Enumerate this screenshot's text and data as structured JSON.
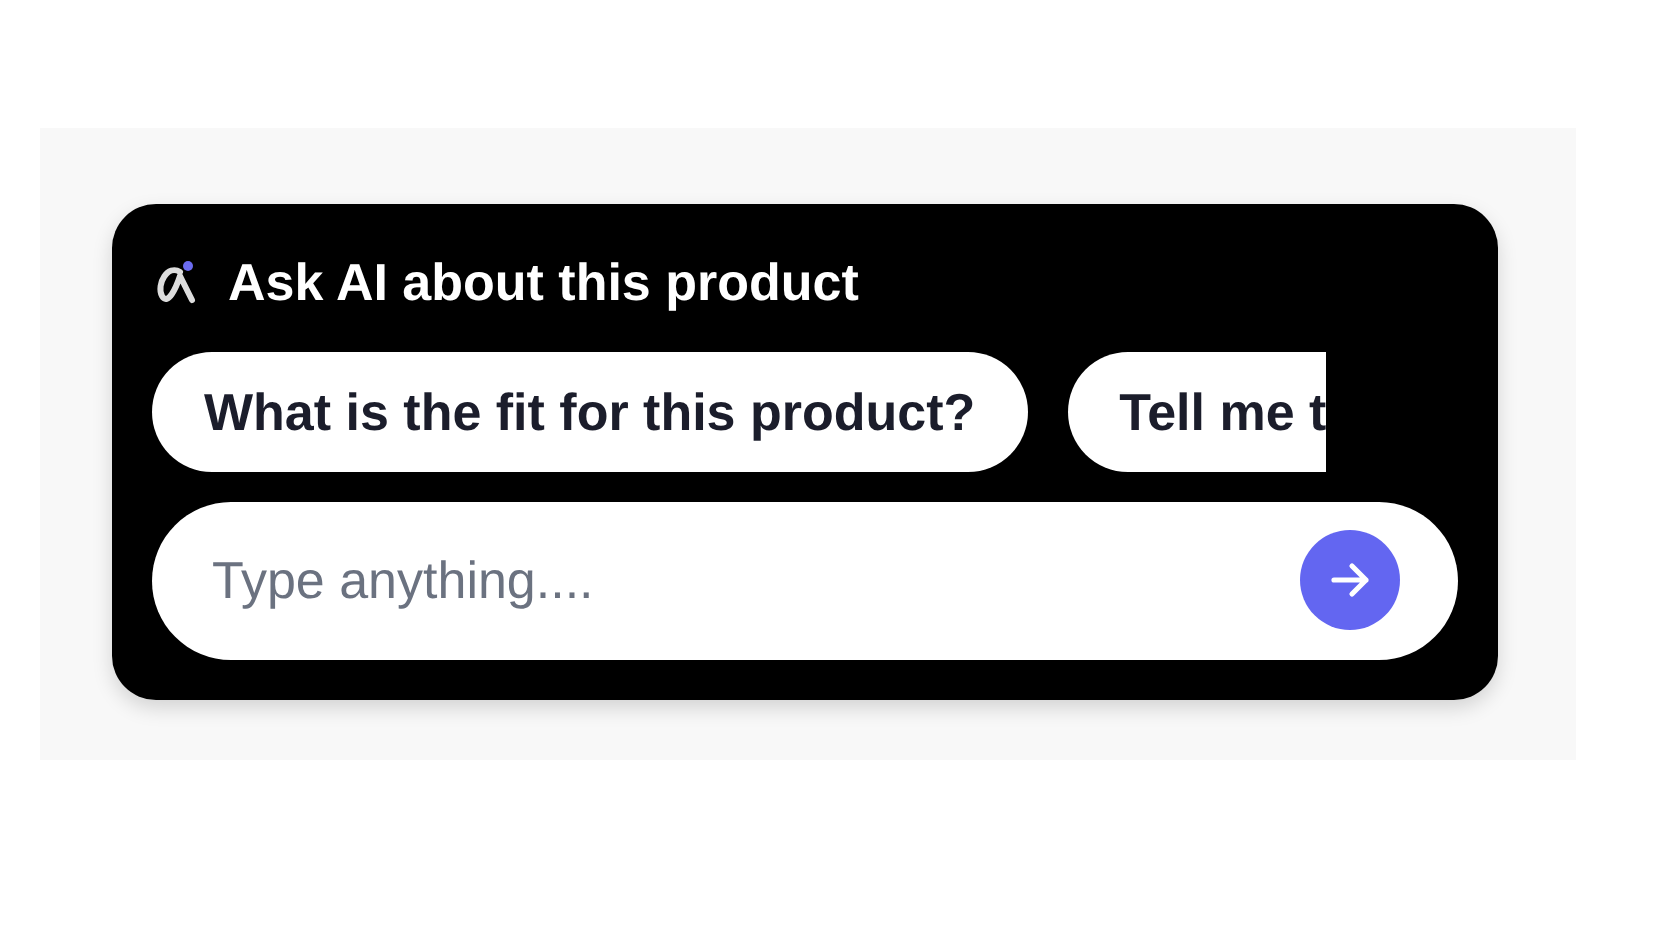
{
  "header": {
    "title": "Ask AI about this product"
  },
  "suggestions": [
    {
      "label": "What is the fit for this product?"
    },
    {
      "label": "Tell me t"
    }
  ],
  "input": {
    "placeholder": "Type anything...."
  }
}
